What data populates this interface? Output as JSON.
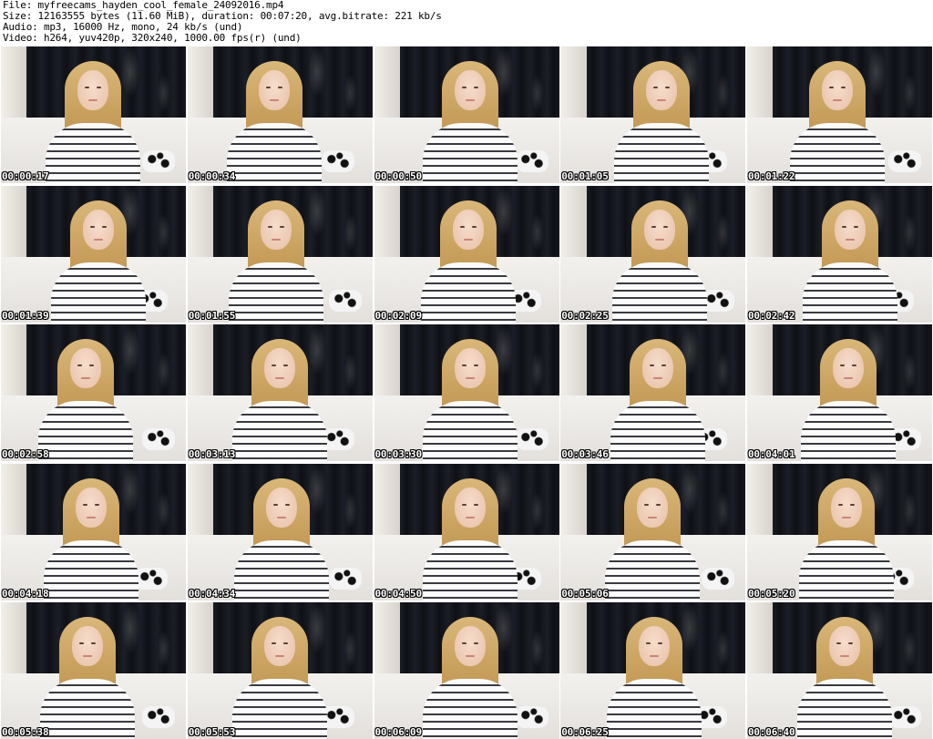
{
  "header": {
    "file_line": "File: myfreecams_hayden_cool_female_24092016.mp4",
    "size_line": "Size: 12163555 bytes (11.60 MiB), duration: 00:07:20, avg.bitrate: 221 kb/s",
    "audio_line": "Audio: mp3, 16000 Hz, mono, 24 kb/s (und)",
    "video_line": "Video: h264, yuv420p, 320x240, 1000.00 fps(r) (und)"
  },
  "thumbnails": [
    {
      "timestamp": "00:00:17"
    },
    {
      "timestamp": "00:00:34"
    },
    {
      "timestamp": "00:00:50"
    },
    {
      "timestamp": "00:01:05"
    },
    {
      "timestamp": "00:01:22"
    },
    {
      "timestamp": "00:01:39"
    },
    {
      "timestamp": "00:01:55"
    },
    {
      "timestamp": "00:02:09"
    },
    {
      "timestamp": "00:02:25"
    },
    {
      "timestamp": "00:02:42"
    },
    {
      "timestamp": "00:02:58"
    },
    {
      "timestamp": "00:03:13"
    },
    {
      "timestamp": "00:03:30"
    },
    {
      "timestamp": "00:03:46"
    },
    {
      "timestamp": "00:04:01"
    },
    {
      "timestamp": "00:04:18"
    },
    {
      "timestamp": "00:04:34"
    },
    {
      "timestamp": "00:04:50"
    },
    {
      "timestamp": "00:05:06"
    },
    {
      "timestamp": "00:05:20"
    },
    {
      "timestamp": "00:05:38"
    },
    {
      "timestamp": "00:05:53"
    },
    {
      "timestamp": "00:06:09"
    },
    {
      "timestamp": "00:06:25"
    },
    {
      "timestamp": "00:06:40"
    }
  ]
}
